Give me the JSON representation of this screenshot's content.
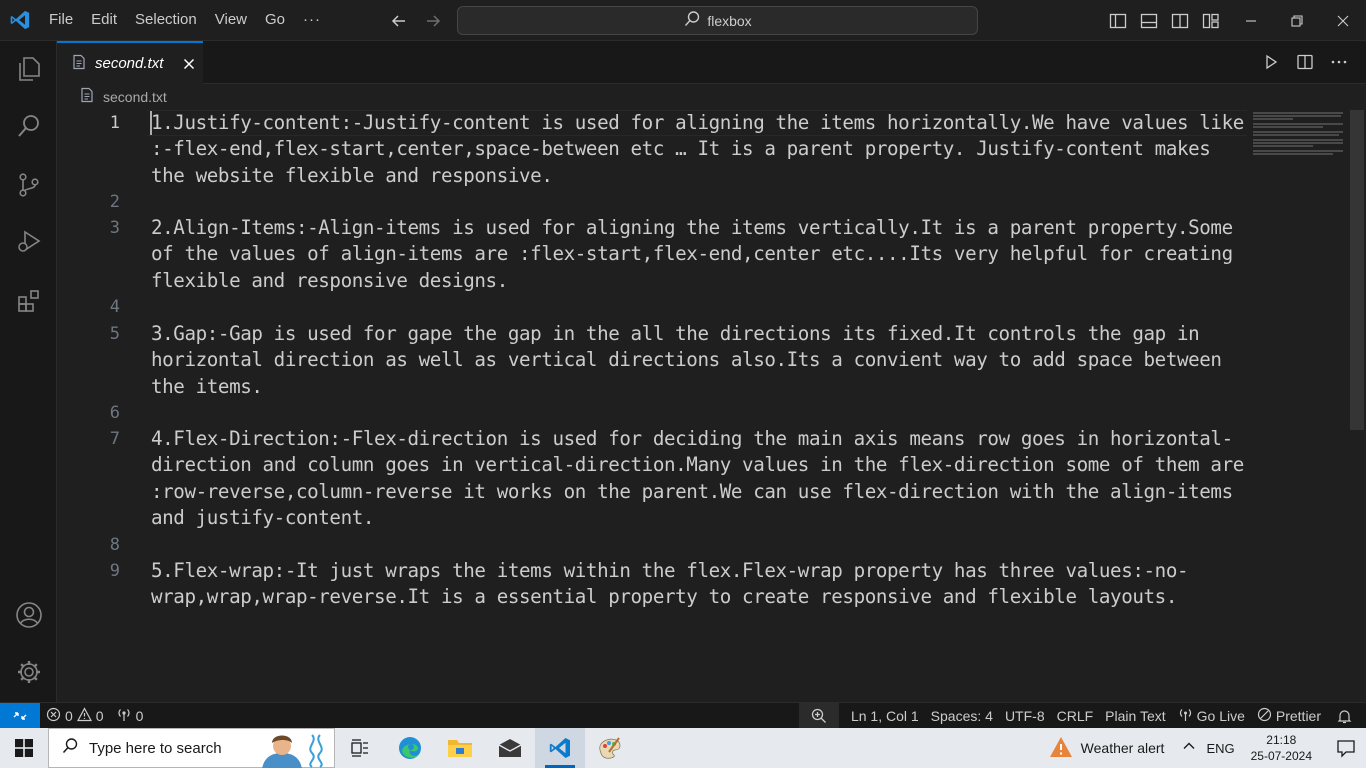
{
  "menu": {
    "items": [
      "File",
      "Edit",
      "Selection",
      "View",
      "Go"
    ],
    "more": "···"
  },
  "command_center": {
    "text": "flexbox"
  },
  "tab": {
    "label": "second.txt"
  },
  "breadcrumb": {
    "file": "second.txt"
  },
  "editor": {
    "line_numbers": [
      "1",
      "2",
      "3",
      "4",
      "5",
      "6",
      "7",
      "8",
      "9"
    ],
    "lines": [
      "1.Justify-content:-Justify-content is used for aligning the items horizontally.We have values like :-flex-end,flex-start,center,space-between etc … It is a parent property. Justify-content makes the website flexible and responsive.",
      "",
      "2.Align-Items:-Align-items is used for aligning the items vertically.It is a parent property.Some of the values of align-items are :flex-start,flex-end,center etc....Its very helpful for creating flexible and responsive designs.",
      "",
      "3.Gap:-Gap is used for gape the gap in the all the directions its fixed.It controls the gap in horizontal direction as well as vertical directions also.Its a convient way to add space between the items.",
      "",
      "4.Flex-Direction:-Flex-direction is used for deciding the main axis means row goes in horizontal-direction and column goes in vertical-direction.Many values in the flex-direction some of them are :row-reverse,column-reverse it works on the parent.We can use flex-direction with the align-items and justify-content.",
      "",
      "5.Flex-wrap:-It just wraps the items within the flex.Flex-wrap property has three values:-no-wrap,wrap,wrap-reverse.It is a essential property to create responsive and flexible layouts."
    ]
  },
  "statusbar": {
    "errors": "0",
    "warnings": "0",
    "ports": "0",
    "position": "Ln 1, Col 1",
    "spaces": "Spaces: 4",
    "encoding": "UTF-8",
    "eol": "CRLF",
    "language": "Plain Text",
    "golive": "Go Live",
    "prettier": "Prettier"
  },
  "taskbar": {
    "search_placeholder": "Type here to search",
    "weather": "Weather alert",
    "lang": "ENG",
    "time": "21:18",
    "date": "25-07-2024"
  },
  "colors": {
    "accent": "#0078d4",
    "editor_bg": "#1f1f1f",
    "sidebar_bg": "#181818"
  }
}
